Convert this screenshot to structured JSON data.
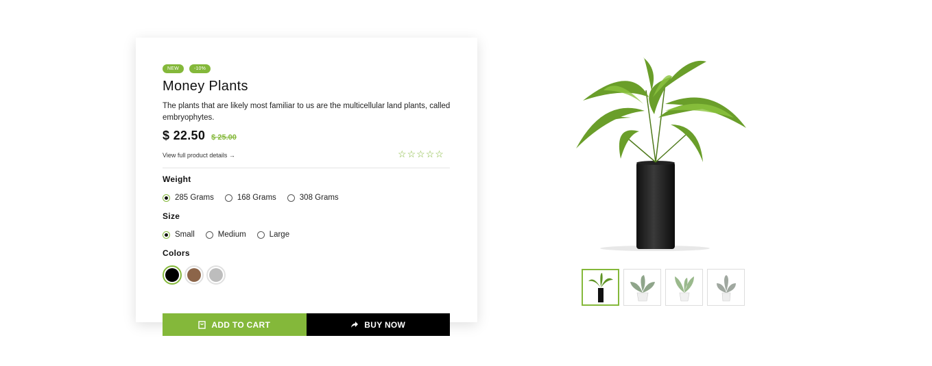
{
  "product": {
    "badges": [
      "NEW",
      "-10%"
    ],
    "title": "Money Plants",
    "description": "The plants that are likely most familiar to us are the multicellular land plants, called embryophytes.",
    "price": "$ 22.50",
    "old_price": "$ 25.00",
    "details_link": "View full product details →",
    "rating": {
      "value": 0,
      "max": 5
    }
  },
  "options": {
    "weight": {
      "label": "Weight",
      "choices": [
        "285 Grams",
        "168 Grams",
        "308 Grams"
      ],
      "selected": "285 Grams"
    },
    "size": {
      "label": "Size",
      "choices": [
        "Small",
        "Medium",
        "Large"
      ],
      "selected": "Small"
    },
    "colors": {
      "label": "Colors",
      "swatches": [
        "#000000",
        "#8c6549",
        "#bdbdbd"
      ],
      "selected": "#000000"
    }
  },
  "actions": {
    "add_to_cart": "ADD TO CART",
    "buy_now": "BUY NOW"
  },
  "theme": {
    "accent": "#84b83a",
    "dark": "#000000"
  },
  "gallery": {
    "thumbnails": [
      "tall-plant-black-pot",
      "plant-white-pot",
      "plant-white-pot-2",
      "plant-white-pot-3"
    ],
    "active": 0
  }
}
